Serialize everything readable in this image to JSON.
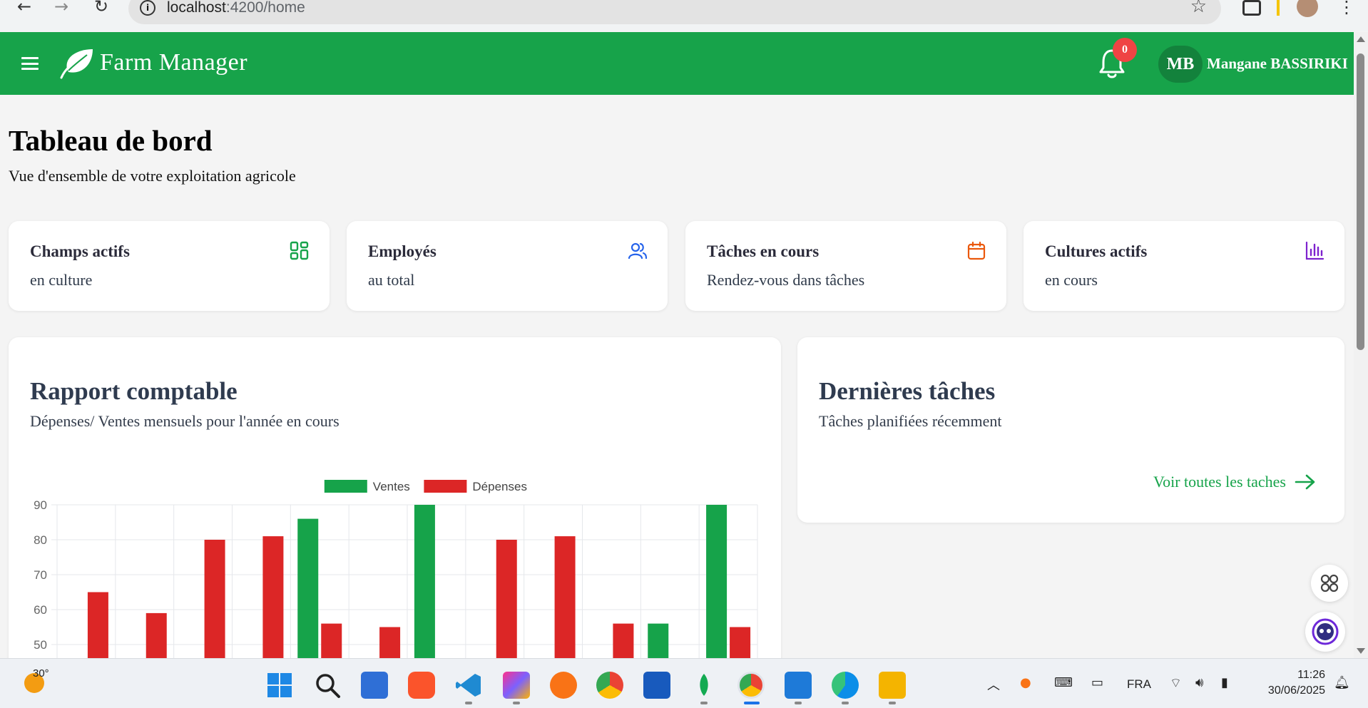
{
  "browser": {
    "url_host": "localhost",
    "url_path": ":4200/home"
  },
  "header": {
    "brand": "Farm Manager",
    "notification_count": "0",
    "avatar_initials": "MB",
    "user_name": "Mangane BASSIRIKI"
  },
  "page": {
    "title": "Tableau de bord",
    "subtitle": "Vue d'ensemble de votre exploitation agricole"
  },
  "stats": [
    {
      "title": "Champs actifs",
      "subtitle": "en culture",
      "icon": "grid-icon",
      "color": "#16a34a"
    },
    {
      "title": "Employés",
      "subtitle": "au total",
      "icon": "users-icon",
      "color": "#2563eb"
    },
    {
      "title": "Tâches en cours",
      "subtitle": "Rendez-vous dans tâches",
      "icon": "calendar-icon",
      "color": "#ea580c"
    },
    {
      "title": "Cultures actifs",
      "subtitle": "en cours",
      "icon": "bar-chart-icon",
      "color": "#7e22ce"
    }
  ],
  "report": {
    "title": "Rapport comptable",
    "subtitle": "Dépenses/ Ventes mensuels pour l'année en cours"
  },
  "tasks": {
    "title": "Dernières tâches",
    "subtitle": "Tâches planifiées récemment",
    "link": "Voir toutes les taches"
  },
  "chart_data": {
    "type": "bar",
    "categories": [
      "",
      "",
      "",
      "",
      "",
      "",
      "",
      "",
      "",
      "",
      "",
      ""
    ],
    "series": [
      {
        "name": "Ventes",
        "color": "#16a34a",
        "values": [
          null,
          null,
          null,
          null,
          86,
          null,
          90,
          null,
          null,
          null,
          56,
          90
        ]
      },
      {
        "name": "Dépenses",
        "color": "#dc2626",
        "values": [
          65,
          59,
          80,
          81,
          56,
          55,
          null,
          80,
          81,
          56,
          null,
          55
        ]
      }
    ],
    "yticks": [
      50,
      60,
      70,
      80,
      90
    ],
    "ylim": [
      50,
      90
    ],
    "legend": "top-center",
    "grid": true
  },
  "taskbar": {
    "temperature": "30°",
    "language": "FRA",
    "time": "11:26",
    "date": "30/06/2025"
  }
}
